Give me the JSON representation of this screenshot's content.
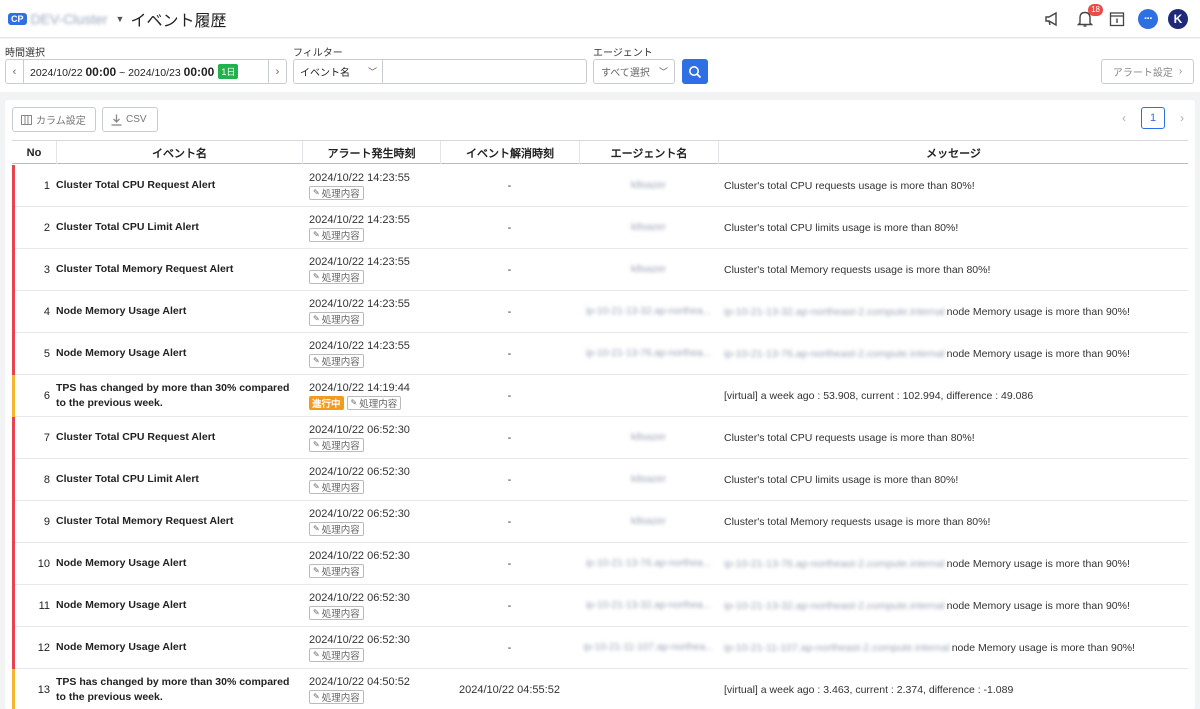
{
  "header": {
    "badge": "CP",
    "cluster": "DEV-Cluster",
    "title": "イベント履歴",
    "notification_count": "18",
    "chat_icon": "···",
    "avatar": "K"
  },
  "filters": {
    "time_label": "時間選択",
    "time_start_date": "2024/10/22",
    "time_start_hm": "00:00",
    "time_sep": "~",
    "time_end_date": "2024/10/23",
    "time_end_hm": "00:00",
    "time_range_badge": "1日",
    "filter_label": "フィルター",
    "filter_field": "イベント名",
    "filter_value": "",
    "agent_label": "エージェント",
    "agent_value": "すべて選択",
    "alert_settings_button": "アラート設定"
  },
  "toolbar": {
    "column_settings": "カラム設定",
    "csv": "CSV"
  },
  "pagination": {
    "current_page": "1"
  },
  "table": {
    "columns": [
      "No",
      "イベント名",
      "アラート発生時刻",
      "イベント解消時刻",
      "エージェント名",
      "メッセージ"
    ],
    "process_label": "処理内容",
    "in_progress_label": "進行中",
    "rows": [
      {
        "no": "1",
        "name": "Cluster Total CPU Request Alert",
        "time": "2024/10/22 14:23:55",
        "resolved": "-",
        "agent": "k8sazer",
        "msg_prefix": "",
        "message": "Cluster's total CPU requests usage is more than 80%!",
        "level": "critical",
        "in_progress": false
      },
      {
        "no": "2",
        "name": "Cluster Total CPU Limit Alert",
        "time": "2024/10/22 14:23:55",
        "resolved": "-",
        "agent": "k8sazer",
        "msg_prefix": "",
        "message": "Cluster's total CPU limits usage is more than 80%!",
        "level": "critical",
        "in_progress": false
      },
      {
        "no": "3",
        "name": "Cluster Total Memory Request Alert",
        "time": "2024/10/22 14:23:55",
        "resolved": "-",
        "agent": "k8sazer",
        "msg_prefix": "",
        "message": "Cluster's total Memory requests usage is more than 80%!",
        "level": "critical",
        "in_progress": false
      },
      {
        "no": "4",
        "name": "Node Memory Usage Alert",
        "time": "2024/10/22 14:23:55",
        "resolved": "-",
        "agent": "ip-10-21-13-32.ap-northea...",
        "msg_prefix": "ip-10-21-13-32.ap-northeast-2.compute.internal",
        "message": "node Memory usage is more than 90%!",
        "level": "critical",
        "in_progress": false
      },
      {
        "no": "5",
        "name": "Node Memory Usage Alert",
        "time": "2024/10/22 14:23:55",
        "resolved": "-",
        "agent": "ip-10-21-13-76.ap-northea...",
        "msg_prefix": "ip-10-21-13-76.ap-northeast-2.compute.internal",
        "message": "node Memory usage is more than 90%!",
        "level": "critical",
        "in_progress": false
      },
      {
        "no": "6",
        "name": "TPS has changed by more than 30% compared to the previous week.",
        "time": "2024/10/22 14:19:44",
        "resolved": "-",
        "agent": "",
        "msg_prefix": "",
        "message": "[virtual] a week ago : 53.908, current : 102.994, difference : 49.086",
        "level": "warning",
        "in_progress": true
      },
      {
        "no": "7",
        "name": "Cluster Total CPU Request Alert",
        "time": "2024/10/22 06:52:30",
        "resolved": "-",
        "agent": "k8sazer",
        "msg_prefix": "",
        "message": "Cluster's total CPU requests usage is more than 80%!",
        "level": "critical",
        "in_progress": false
      },
      {
        "no": "8",
        "name": "Cluster Total CPU Limit Alert",
        "time": "2024/10/22 06:52:30",
        "resolved": "-",
        "agent": "k8sazer",
        "msg_prefix": "",
        "message": "Cluster's total CPU limits usage is more than 80%!",
        "level": "critical",
        "in_progress": false
      },
      {
        "no": "9",
        "name": "Cluster Total Memory Request Alert",
        "time": "2024/10/22 06:52:30",
        "resolved": "-",
        "agent": "k8sazer",
        "msg_prefix": "",
        "message": "Cluster's total Memory requests usage is more than 80%!",
        "level": "critical",
        "in_progress": false
      },
      {
        "no": "10",
        "name": "Node Memory Usage Alert",
        "time": "2024/10/22 06:52:30",
        "resolved": "-",
        "agent": "ip-10-21-13-76.ap-northea...",
        "msg_prefix": "ip-10-21-13-76.ap-northeast-2.compute.internal",
        "message": "node Memory usage is more than 90%!",
        "level": "critical",
        "in_progress": false
      },
      {
        "no": "11",
        "name": "Node Memory Usage Alert",
        "time": "2024/10/22 06:52:30",
        "resolved": "-",
        "agent": "ip-10-21-13-32.ap-northea...",
        "msg_prefix": "ip-10-21-13-32.ap-northeast-2.compute.internal",
        "message": "node Memory usage is more than 90%!",
        "level": "critical",
        "in_progress": false
      },
      {
        "no": "12",
        "name": "Node Memory Usage Alert",
        "time": "2024/10/22 06:52:30",
        "resolved": "-",
        "agent": "ip-10-21-11-107.ap-northea...",
        "msg_prefix": "ip-10-21-11-107.ap-northeast-2.compute.internal",
        "message": "node Memory usage is more than 90%!",
        "level": "critical",
        "in_progress": false
      },
      {
        "no": "13",
        "name": "TPS has changed by more than 30% compared to the previous week.",
        "time": "2024/10/22 04:50:52",
        "resolved": "2024/10/22 04:55:52",
        "agent": "",
        "msg_prefix": "",
        "message": "[virtual] a week ago : 3.463, current : 2.374, difference : -1.089",
        "level": "warning",
        "in_progress": false
      }
    ]
  },
  "colors": {
    "accent": "#2f6fe4",
    "critical": "#e8434f",
    "warning": "#f6b52e",
    "in_progress": "#f39b1f",
    "day_badge": "#23b14d"
  }
}
